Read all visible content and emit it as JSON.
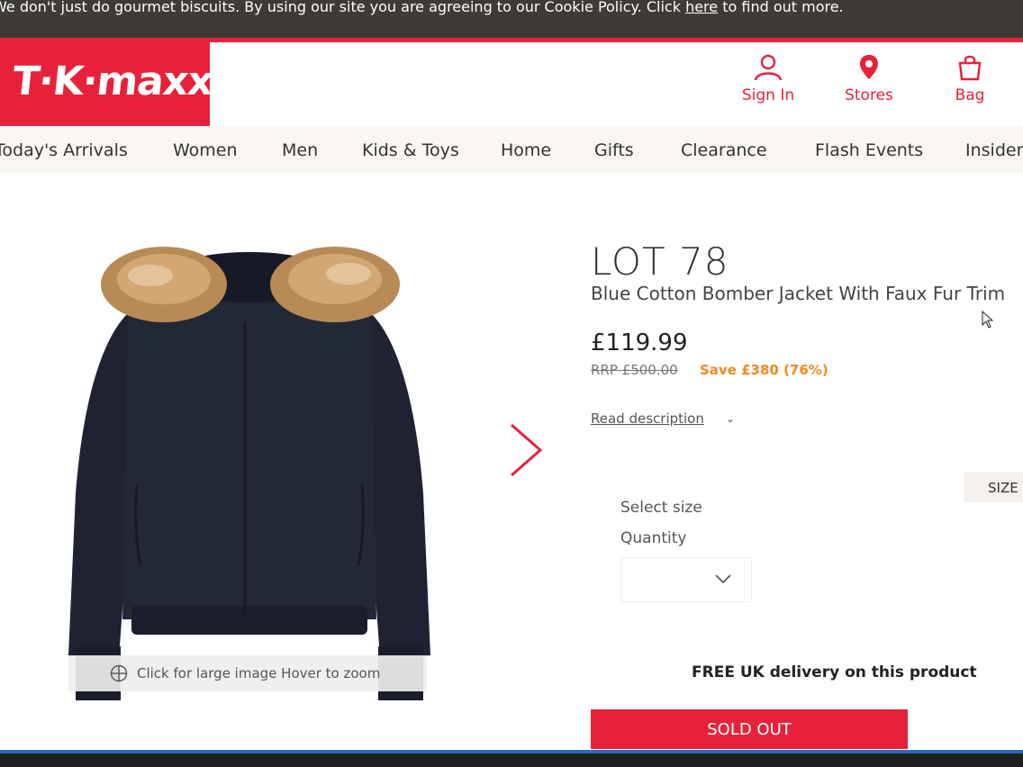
{
  "cookie": {
    "text_before": "We don't just do gourmet biscuits. By using our site you are agreeing to our Cookie Policy. Click ",
    "link": "here",
    "text_after": " to find out more."
  },
  "logo": {
    "text": "T·K·maxx",
    "icon": "tkmaxx-logo"
  },
  "header": {
    "sign_in": "Sign In",
    "stores": "Stores",
    "bag": "Bag",
    "icons": [
      "user-icon",
      "location-pin-icon",
      "bag-icon"
    ]
  },
  "nav": {
    "items": [
      "Today's Arrivals",
      "Women",
      "Men",
      "Kids & Toys",
      "Home",
      "Gifts",
      "Clearance",
      "Flash Events",
      "Insider"
    ]
  },
  "gallery": {
    "zoom_hint": "Click for large image Hover to zoom",
    "image": "navy-bomber-jacket-with-fur-hood"
  },
  "product": {
    "brand": "LOT 78",
    "name": "Blue Cotton Bomber Jacket With Faux Fur Trim",
    "price": "£119.99",
    "rrp": "RRP £500.00",
    "save": "Save £380 (76%)",
    "read_description": "Read description",
    "size_tab": "SIZE",
    "select_size": "Select size",
    "quantity_label": "Quantity",
    "quantity_value": "",
    "delivery": "FREE UK delivery on this product",
    "sold_out": "SOLD OUT"
  },
  "colors": {
    "brand_red": "#e8213a",
    "save_orange": "#f08a24",
    "nav_bg": "#faf6f1",
    "cookie_bg": "#3d3a38"
  }
}
